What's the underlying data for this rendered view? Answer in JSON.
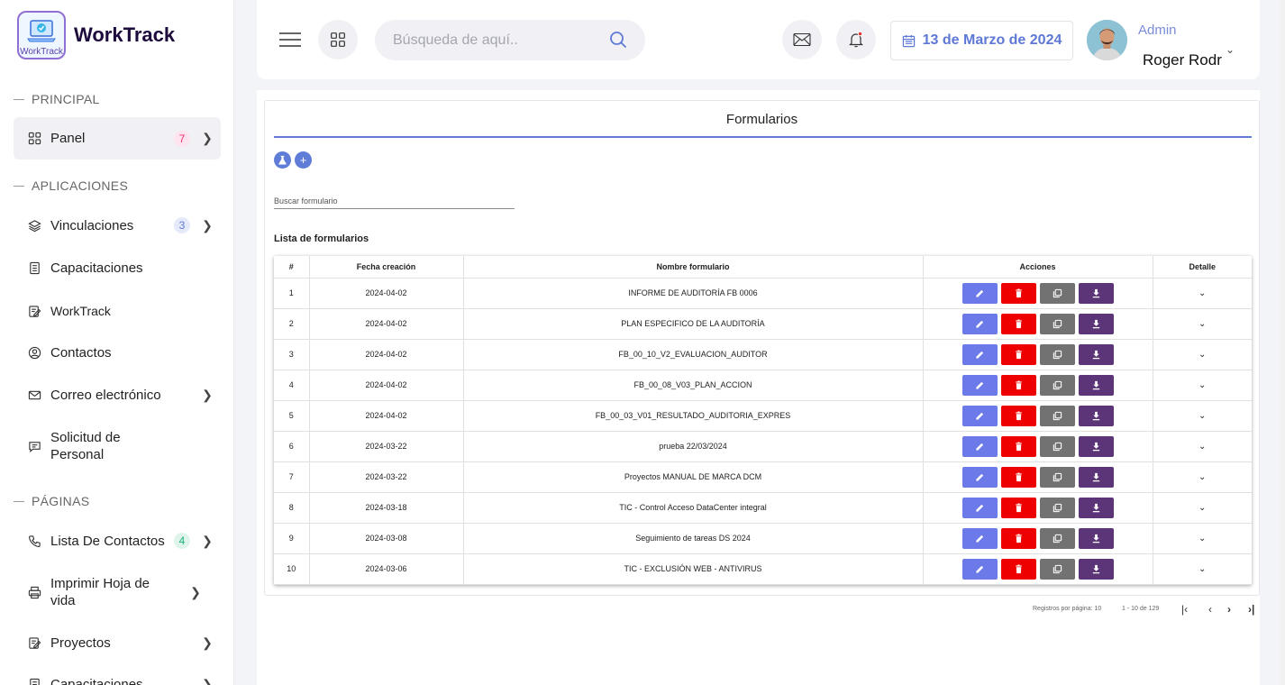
{
  "brand": {
    "name": "WorkTrack",
    "logo_text": "WorkTrack"
  },
  "sidebar": {
    "sections": [
      "PRINCIPAL",
      "APLICACIONES",
      "PÁGINAS"
    ],
    "items": [
      {
        "label": "Panel",
        "icon": "grid-icon",
        "badge": "7"
      },
      {
        "label": "Vinculaciones",
        "icon": "layers-icon",
        "badge": "3"
      },
      {
        "label": "Capacitaciones",
        "icon": "document-icon"
      },
      {
        "label": "WorkTrack",
        "icon": "edit-document-icon"
      },
      {
        "label": "Contactos",
        "icon": "user-circle-icon"
      },
      {
        "label": "Correo electrónico",
        "icon": "mail-icon"
      },
      {
        "label": "Solicitud de Personal",
        "icon": "chat-icon"
      },
      {
        "label": "Lista De Contactos",
        "icon": "phone-icon",
        "badge": "4"
      },
      {
        "label": "Imprimir Hoja de vida",
        "icon": "printer-icon"
      },
      {
        "label": "Proyectos",
        "icon": "edit-document-icon"
      },
      {
        "label": "Capacitaciones",
        "icon": "document-icon"
      }
    ],
    "colors": {
      "badge_pink": "#e8317b",
      "badge_blue": "#5f7cd6",
      "badge_green": "#1bb07a"
    }
  },
  "header": {
    "search_placeholder": "Búsqueda de aquí..",
    "date": "13 de Marzo de 2024",
    "user_role": "Admin",
    "user_name": "Roger Rodr"
  },
  "main": {
    "title": "Formularios",
    "filter_label": "Buscar formulario",
    "list_title": "Lista de formularios",
    "columns": [
      "#",
      "Fecha creación",
      "Nombre formulario",
      "Acciones",
      "Detalle"
    ],
    "rows": [
      {
        "n": "1",
        "date": "2024-04-02",
        "name": "INFORME DE AUDITORÍA FB 0006"
      },
      {
        "n": "2",
        "date": "2024-04-02",
        "name": "PLAN ESPECIFICO DE LA AUDITORÍA"
      },
      {
        "n": "3",
        "date": "2024-04-02",
        "name": "FB_00_10_V2_EVALUACION_AUDITOR"
      },
      {
        "n": "4",
        "date": "2024-04-02",
        "name": "FB_00_08_V03_PLAN_ACCION"
      },
      {
        "n": "5",
        "date": "2024-04-02",
        "name": "FB_00_03_V01_RESULTADO_AUDITORIA_EXPRES"
      },
      {
        "n": "6",
        "date": "2024-03-22",
        "name": "prueba 22/03/2024"
      },
      {
        "n": "7",
        "date": "2024-03-22",
        "name": "Proyectos MANUAL DE MARCA DCM"
      },
      {
        "n": "8",
        "date": "2024-03-18",
        "name": "TIC - Control Acceso DataCenter integral"
      },
      {
        "n": "9",
        "date": "2024-03-08",
        "name": "Seguimiento de tareas DS 2024"
      },
      {
        "n": "10",
        "date": "2024-03-06",
        "name": "TIC - EXCLUSIÓN WEB - ANTIVIRUS"
      }
    ],
    "pagination": {
      "per_page_label": "Registros por página: 10",
      "range": "1 - 10 de 129"
    },
    "action_colors": {
      "edit": "#6b7ae8",
      "delete": "#ee0000",
      "copy": "#727272",
      "download": "#5c3478"
    }
  }
}
